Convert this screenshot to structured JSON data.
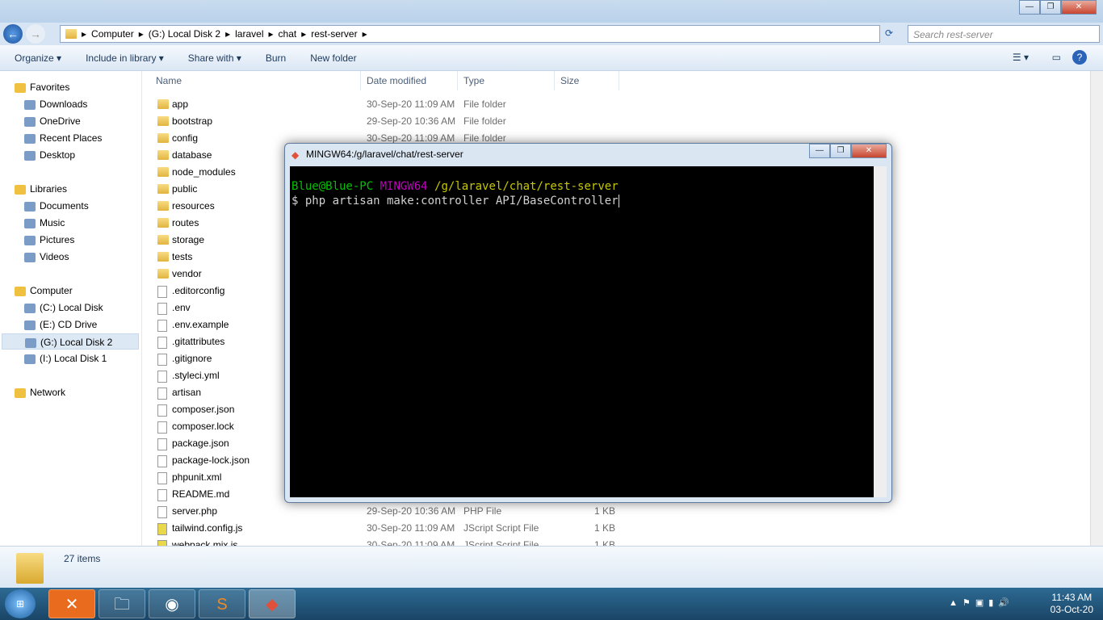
{
  "explorer": {
    "breadcrumb": [
      "Computer",
      "(G:) Local Disk 2",
      "laravel",
      "chat",
      "rest-server"
    ],
    "search_placeholder": "Search rest-server",
    "toolbar": {
      "organize": "Organize ▾",
      "include": "Include in library ▾",
      "share": "Share with ▾",
      "burn": "Burn",
      "new_folder": "New folder"
    },
    "nav": [
      {
        "label": "Favorites",
        "group": true
      },
      {
        "label": "Downloads"
      },
      {
        "label": "OneDrive"
      },
      {
        "label": "Recent Places"
      },
      {
        "label": "Desktop"
      },
      {
        "label": "Libraries",
        "group": true
      },
      {
        "label": "Documents"
      },
      {
        "label": "Music"
      },
      {
        "label": "Pictures"
      },
      {
        "label": "Videos"
      },
      {
        "label": "Computer",
        "group": true
      },
      {
        "label": "(C:) Local Disk"
      },
      {
        "label": "(E:) CD Drive"
      },
      {
        "label": "(G:) Local Disk 2",
        "selected": true
      },
      {
        "label": "(I:) Local Disk 1"
      },
      {
        "label": "Network",
        "group": true
      }
    ],
    "columns": {
      "name": "Name",
      "date": "Date modified",
      "type": "Type",
      "size": "Size"
    },
    "files": [
      {
        "name": "app",
        "date": "30-Sep-20 11:09 AM",
        "type": "File folder",
        "size": "",
        "icon": "folder"
      },
      {
        "name": "bootstrap",
        "date": "29-Sep-20 10:36 AM",
        "type": "File folder",
        "size": "",
        "icon": "folder"
      },
      {
        "name": "config",
        "date": "30-Sep-20 11:09 AM",
        "type": "File folder",
        "size": "",
        "icon": "folder"
      },
      {
        "name": "database",
        "date": "",
        "type": "",
        "size": "",
        "icon": "folder"
      },
      {
        "name": "node_modules",
        "date": "",
        "type": "",
        "size": "",
        "icon": "folder"
      },
      {
        "name": "public",
        "date": "",
        "type": "",
        "size": "",
        "icon": "folder"
      },
      {
        "name": "resources",
        "date": "",
        "type": "",
        "size": "",
        "icon": "folder"
      },
      {
        "name": "routes",
        "date": "",
        "type": "",
        "size": "",
        "icon": "folder"
      },
      {
        "name": "storage",
        "date": "",
        "type": "",
        "size": "",
        "icon": "folder"
      },
      {
        "name": "tests",
        "date": "",
        "type": "",
        "size": "",
        "icon": "folder"
      },
      {
        "name": "vendor",
        "date": "",
        "type": "",
        "size": "",
        "icon": "folder"
      },
      {
        "name": ".editorconfig",
        "date": "",
        "type": "",
        "size": "",
        "icon": "file"
      },
      {
        "name": ".env",
        "date": "",
        "type": "",
        "size": "",
        "icon": "file"
      },
      {
        "name": ".env.example",
        "date": "",
        "type": "",
        "size": "",
        "icon": "file"
      },
      {
        "name": ".gitattributes",
        "date": "",
        "type": "",
        "size": "",
        "icon": "file"
      },
      {
        "name": ".gitignore",
        "date": "",
        "type": "",
        "size": "",
        "icon": "file"
      },
      {
        "name": ".styleci.yml",
        "date": "",
        "type": "",
        "size": "",
        "icon": "file"
      },
      {
        "name": "artisan",
        "date": "",
        "type": "",
        "size": "",
        "icon": "file"
      },
      {
        "name": "composer.json",
        "date": "",
        "type": "",
        "size": "",
        "icon": "file"
      },
      {
        "name": "composer.lock",
        "date": "",
        "type": "",
        "size": "",
        "icon": "file"
      },
      {
        "name": "package.json",
        "date": "",
        "type": "",
        "size": "",
        "icon": "file"
      },
      {
        "name": "package-lock.json",
        "date": "",
        "type": "",
        "size": "",
        "icon": "file"
      },
      {
        "name": "phpunit.xml",
        "date": "",
        "type": "",
        "size": "",
        "icon": "file"
      },
      {
        "name": "README.md",
        "date": "",
        "type": "",
        "size": "",
        "icon": "file"
      },
      {
        "name": "server.php",
        "date": "29-Sep-20 10:36 AM",
        "type": "PHP File",
        "size": "1 KB",
        "icon": "file"
      },
      {
        "name": "tailwind.config.js",
        "date": "30-Sep-20 11:09 AM",
        "type": "JScript Script File",
        "size": "1 KB",
        "icon": "script"
      },
      {
        "name": "webpack.mix.js",
        "date": "30-Sep-20 11:09 AM",
        "type": "JScript Script File",
        "size": "1 KB",
        "icon": "script"
      }
    ],
    "status": "27 items"
  },
  "terminal": {
    "title": "MINGW64:/g/laravel/chat/rest-server",
    "user": "Blue@Blue-PC",
    "env": "MINGW64",
    "path": "/g/laravel/chat/rest-server",
    "command": "$ php artisan make:controller API/BaseController",
    "colors": {
      "user": "#00c200",
      "env": "#c000c0",
      "path": "#c8c800",
      "text": "#d0d0d0"
    }
  },
  "taskbar": {
    "time": "11:43 AM",
    "date": "03-Oct-20"
  }
}
